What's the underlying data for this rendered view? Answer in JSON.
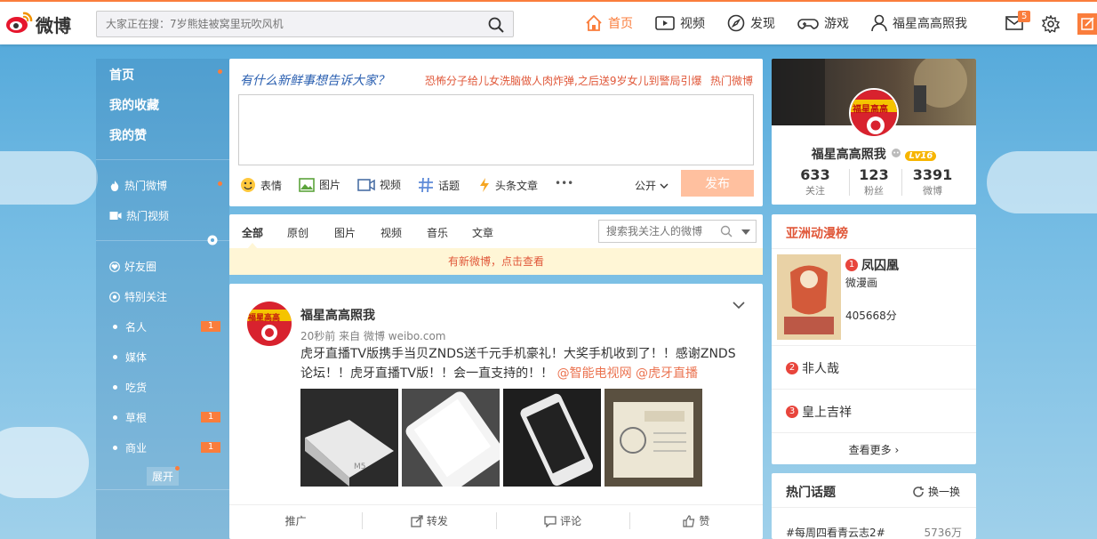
{
  "colors": {
    "accent": "#fa7d3c",
    "link": "#eb7350",
    "publish_disabled": "#ffc09f",
    "notice_bg": "#fff6d6"
  },
  "header": {
    "logo_text": "微博",
    "search_placeholder": "大家正在搜：7岁熊娃被窝里玩吹风机",
    "nav": {
      "home": "首页",
      "video": "视频",
      "discover": "发现",
      "game": "游戏",
      "user": "福星高高照我"
    },
    "message_count": "5"
  },
  "sidebar": {
    "main": [
      "首页",
      "我的收藏",
      "我的赞"
    ],
    "hot": [
      "热门微博",
      "热门视频"
    ],
    "groups": [
      "好友圈",
      "特别关注"
    ],
    "lists": [
      {
        "label": "名人",
        "badge": "1"
      },
      {
        "label": "媒体",
        "badge": ""
      },
      {
        "label": "吃货",
        "badge": ""
      },
      {
        "label": "草根",
        "badge": "1"
      },
      {
        "label": "商业",
        "badge": "1"
      }
    ],
    "expand": "展开"
  },
  "publisher": {
    "prompt": "有什么新鲜事想告诉大家？",
    "hot_topic": "恐怖分子给儿女洗脑做人肉炸弹,之后送9岁女儿到警局引爆",
    "hot_link": "热门微博",
    "tools": [
      "表情",
      "图片",
      "视频",
      "话题",
      "头条文章"
    ],
    "more": "•••",
    "visibility": "公开",
    "submit": "发布"
  },
  "feed_tabs": {
    "tabs": [
      "全部",
      "原创",
      "图片",
      "视频",
      "音乐",
      "文章"
    ],
    "search_placeholder": "搜索我关注人的微博",
    "new_notice": "有新微博，点击查看"
  },
  "post": {
    "author": "福星高高照我",
    "avatar_text": "福星高高",
    "time": "20秒前",
    "source_prefix": "来自",
    "source": "微博 weibo.com",
    "text": "虎牙直播TV版携手当贝ZNDS送千元手机豪礼！大奖手机收到了！！感谢ZNDS论坛！！虎牙直播TV版！！会一直支持的！！",
    "mentions": [
      "@智能电视网",
      "@虎牙直播"
    ],
    "actions": [
      "推广",
      "转发",
      "评论",
      "赞"
    ]
  },
  "profile": {
    "name": "福星高高照我",
    "level": "Lv16",
    "stats": [
      {
        "value": "633",
        "label": "关注"
      },
      {
        "value": "123",
        "label": "粉丝"
      },
      {
        "value": "3391",
        "label": "微博"
      }
    ]
  },
  "ranking": {
    "title": "亚洲动漫榜",
    "items": [
      {
        "rank": "1",
        "name": "凤囚凰",
        "category": "微漫画",
        "score": "405668分"
      },
      {
        "rank": "2",
        "name": "非人哉"
      },
      {
        "rank": "3",
        "name": "皇上吉祥"
      }
    ],
    "more": "查看更多"
  },
  "topics": {
    "title": "热门话题",
    "refresh": "换一换",
    "items": [
      {
        "name": "#每周四看青云志2#",
        "count": "5736万"
      }
    ]
  }
}
